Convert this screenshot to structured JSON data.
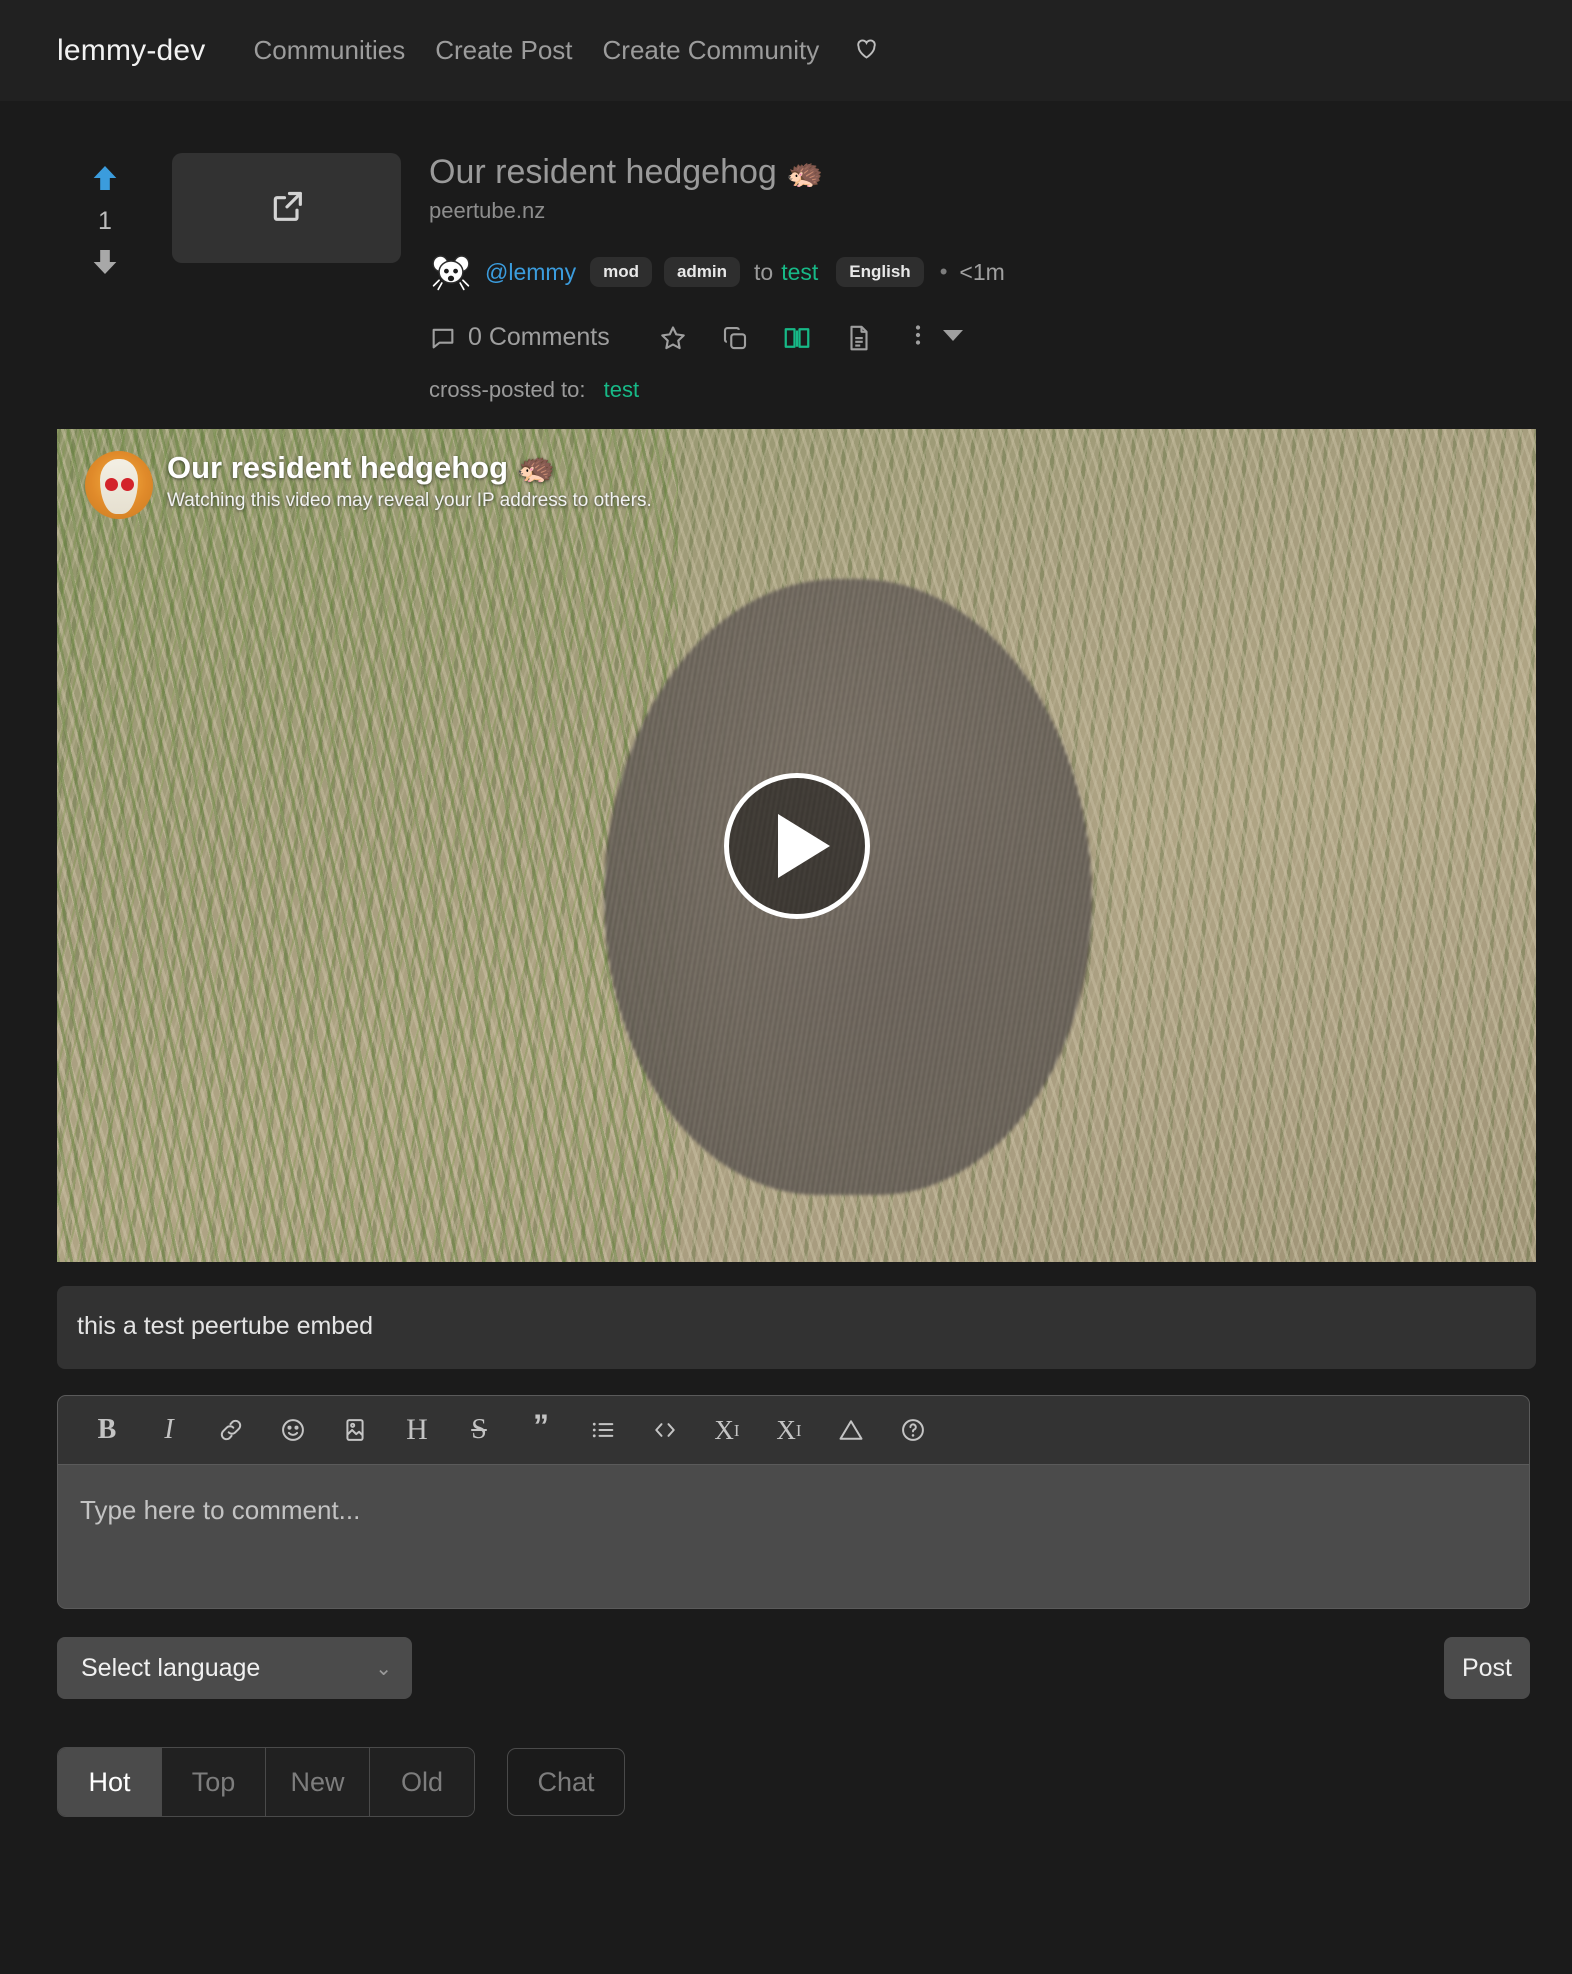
{
  "navbar": {
    "brand": "lemmy-dev",
    "links": [
      {
        "label": "Communities",
        "name": "nav-communities"
      },
      {
        "label": "Create Post",
        "name": "nav-create-post"
      },
      {
        "label": "Create Community",
        "name": "nav-create-community"
      }
    ],
    "heart_icon": "heart-icon"
  },
  "post": {
    "score": "1",
    "upvote_color": "#3b9cdd",
    "downvote_color": "#a8a8a8",
    "thumbnail_icon": "external-link-icon",
    "title": "Our resident hedgehog",
    "title_emoji": "🦔",
    "domain": "peertube.nz",
    "creator": "@lemmy",
    "creator_color": "#3b9cdd",
    "badges": [
      "mod",
      "admin"
    ],
    "to_label": "to",
    "community": "test",
    "community_color": "#17b987",
    "language_badge": "English",
    "separator": "•",
    "time_ago": "<1m",
    "comments_label": "0 Comments",
    "actions": [
      {
        "name": "save-star-icon",
        "color": "#9f9f9f"
      },
      {
        "name": "cross-post-copy-icon",
        "color": "#9f9f9f"
      },
      {
        "name": "mark-as-read-book-icon",
        "color": "#17b987"
      },
      {
        "name": "view-source-file-icon",
        "color": "#9f9f9f"
      }
    ],
    "more_icon": "vertical-dots-icon",
    "more_caret_icon": "chevron-down-icon",
    "crossposted_label": "cross-posted to:",
    "crossposted_community": "test",
    "body_text": "this a test peertube embed"
  },
  "video": {
    "avatar_icon": "peertube-channel-avatar",
    "title": "Our resident hedgehog",
    "title_emoji": "🦔",
    "privacy_notice": "Watching this video may reveal your IP address to others.",
    "play_icon": "play-button-icon"
  },
  "editor": {
    "toolbar": [
      {
        "name": "bold-icon",
        "glyph": "B"
      },
      {
        "name": "italic-icon",
        "glyph": "I"
      },
      {
        "name": "link-icon",
        "glyph": "🔗"
      },
      {
        "name": "emoji-icon",
        "glyph": "☺"
      },
      {
        "name": "image-icon",
        "glyph": "🖼"
      },
      {
        "name": "header-icon",
        "glyph": "H"
      },
      {
        "name": "strikethrough-icon",
        "glyph": "S"
      },
      {
        "name": "quote-icon",
        "glyph": "”"
      },
      {
        "name": "list-icon",
        "glyph": "☰"
      },
      {
        "name": "code-icon",
        "glyph": "<>"
      },
      {
        "name": "subscript-icon",
        "glyph": "X"
      },
      {
        "name": "superscript-icon",
        "glyph": "X"
      },
      {
        "name": "spoiler-warning-icon",
        "glyph": "⚠"
      },
      {
        "name": "help-icon",
        "glyph": "?"
      }
    ],
    "comment_placeholder": "Type here to comment...",
    "language_select_label": "Select language",
    "language_caret": "⌄",
    "post_button": "Post"
  },
  "sort": {
    "tabs": [
      {
        "label": "Hot",
        "active": true
      },
      {
        "label": "Top",
        "active": false
      },
      {
        "label": "New",
        "active": false
      },
      {
        "label": "Old",
        "active": false
      }
    ],
    "chat_label": "Chat"
  }
}
